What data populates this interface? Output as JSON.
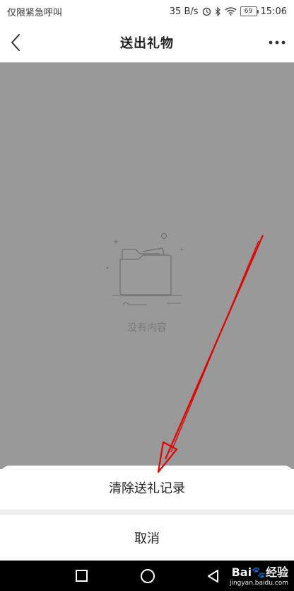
{
  "status_bar": {
    "carrier": "仅限紧急呼叫",
    "speed": "35 B/s",
    "battery": "69",
    "time": "15:06"
  },
  "header": {
    "title": "送出礼物",
    "back_icon": "chevron-left-icon",
    "more_icon": "more-dots-icon"
  },
  "content": {
    "empty_text": "没有内容",
    "empty_icon": "empty-folder-icon"
  },
  "sheet": {
    "clear_label": "清除送礼记录",
    "cancel_label": "取消"
  },
  "watermark": {
    "brand": "Bai",
    "brand_suffix": "经验",
    "domain": "jingyan.baidu.com"
  },
  "colors": {
    "dim_background": "#999999",
    "annotation": "#e00000"
  }
}
